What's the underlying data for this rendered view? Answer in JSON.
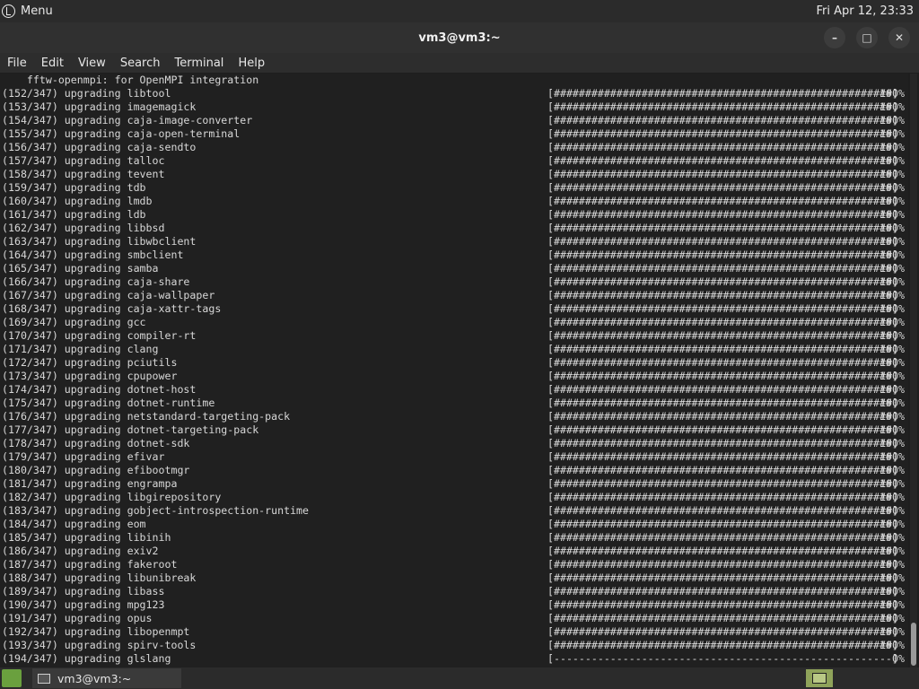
{
  "top_panel": {
    "menu_label": "Menu",
    "clock": "Fri Apr 12, 23:33"
  },
  "window": {
    "title": "vm3@vm3:~",
    "minimize": "–",
    "maximize": "□",
    "close": "✕"
  },
  "menubar": [
    "File",
    "Edit",
    "View",
    "Search",
    "Terminal",
    "Help"
  ],
  "terminal": {
    "first_line": "    fftw-openmpi: for OpenMPI integration",
    "rows": [
      {
        "left": "(152/347) upgrading libtool",
        "bar": "[######################################################]",
        "pct": "100%"
      },
      {
        "left": "(153/347) upgrading imagemagick",
        "bar": "[######################################################]",
        "pct": "100%"
      },
      {
        "left": "(154/347) upgrading caja-image-converter",
        "bar": "[######################################################]",
        "pct": "100%"
      },
      {
        "left": "(155/347) upgrading caja-open-terminal",
        "bar": "[######################################################]",
        "pct": "100%"
      },
      {
        "left": "(156/347) upgrading caja-sendto",
        "bar": "[######################################################]",
        "pct": "100%"
      },
      {
        "left": "(157/347) upgrading talloc",
        "bar": "[######################################################]",
        "pct": "100%"
      },
      {
        "left": "(158/347) upgrading tevent",
        "bar": "[######################################################]",
        "pct": "100%"
      },
      {
        "left": "(159/347) upgrading tdb",
        "bar": "[######################################################]",
        "pct": "100%"
      },
      {
        "left": "(160/347) upgrading lmdb",
        "bar": "[######################################################]",
        "pct": "100%"
      },
      {
        "left": "(161/347) upgrading ldb",
        "bar": "[######################################################]",
        "pct": "100%"
      },
      {
        "left": "(162/347) upgrading libbsd",
        "bar": "[######################################################]",
        "pct": "100%"
      },
      {
        "left": "(163/347) upgrading libwbclient",
        "bar": "[######################################################]",
        "pct": "100%"
      },
      {
        "left": "(164/347) upgrading smbclient",
        "bar": "[######################################################]",
        "pct": "100%"
      },
      {
        "left": "(165/347) upgrading samba",
        "bar": "[######################################################]",
        "pct": "100%"
      },
      {
        "left": "(166/347) upgrading caja-share",
        "bar": "[######################################################]",
        "pct": "100%"
      },
      {
        "left": "(167/347) upgrading caja-wallpaper",
        "bar": "[######################################################]",
        "pct": "100%"
      },
      {
        "left": "(168/347) upgrading caja-xattr-tags",
        "bar": "[######################################################]",
        "pct": "100%"
      },
      {
        "left": "(169/347) upgrading gcc",
        "bar": "[######################################################]",
        "pct": "100%"
      },
      {
        "left": "(170/347) upgrading compiler-rt",
        "bar": "[######################################################]",
        "pct": "100%"
      },
      {
        "left": "(171/347) upgrading clang",
        "bar": "[######################################################]",
        "pct": "100%"
      },
      {
        "left": "(172/347) upgrading pciutils",
        "bar": "[######################################################]",
        "pct": "100%"
      },
      {
        "left": "(173/347) upgrading cpupower",
        "bar": "[######################################################]",
        "pct": "100%"
      },
      {
        "left": "(174/347) upgrading dotnet-host",
        "bar": "[######################################################]",
        "pct": "100%"
      },
      {
        "left": "(175/347) upgrading dotnet-runtime",
        "bar": "[######################################################]",
        "pct": "100%"
      },
      {
        "left": "(176/347) upgrading netstandard-targeting-pack",
        "bar": "[######################################################]",
        "pct": "100%"
      },
      {
        "left": "(177/347) upgrading dotnet-targeting-pack",
        "bar": "[######################################################]",
        "pct": "100%"
      },
      {
        "left": "(178/347) upgrading dotnet-sdk",
        "bar": "[######################################################]",
        "pct": "100%"
      },
      {
        "left": "(179/347) upgrading efivar",
        "bar": "[######################################################]",
        "pct": "100%"
      },
      {
        "left": "(180/347) upgrading efibootmgr",
        "bar": "[######################################################]",
        "pct": "100%"
      },
      {
        "left": "(181/347) upgrading engrampa",
        "bar": "[######################################################]",
        "pct": "100%"
      },
      {
        "left": "(182/347) upgrading libgirepository",
        "bar": "[######################################################]",
        "pct": "100%"
      },
      {
        "left": "(183/347) upgrading gobject-introspection-runtime",
        "bar": "[######################################################]",
        "pct": "100%"
      },
      {
        "left": "(184/347) upgrading eom",
        "bar": "[######################################################]",
        "pct": "100%"
      },
      {
        "left": "(185/347) upgrading libinih",
        "bar": "[######################################################]",
        "pct": "100%"
      },
      {
        "left": "(186/347) upgrading exiv2",
        "bar": "[######################################################]",
        "pct": "100%"
      },
      {
        "left": "(187/347) upgrading fakeroot",
        "bar": "[######################################################]",
        "pct": "100%"
      },
      {
        "left": "(188/347) upgrading libunibreak",
        "bar": "[######################################################]",
        "pct": "100%"
      },
      {
        "left": "(189/347) upgrading libass",
        "bar": "[######################################################]",
        "pct": "100%"
      },
      {
        "left": "(190/347) upgrading mpg123",
        "bar": "[######################################################]",
        "pct": "100%"
      },
      {
        "left": "(191/347) upgrading opus",
        "bar": "[######################################################]",
        "pct": "100%"
      },
      {
        "left": "(192/347) upgrading libopenmpt",
        "bar": "[######################################################]",
        "pct": "100%"
      },
      {
        "left": "(193/347) upgrading spirv-tools",
        "bar": "[######################################################]",
        "pct": "100%"
      },
      {
        "left": "(194/347) upgrading glslang",
        "bar": "[------------------------------------------------------]",
        "pct": "0%"
      }
    ]
  },
  "taskbar": {
    "task_label": "vm3@vm3:~"
  }
}
